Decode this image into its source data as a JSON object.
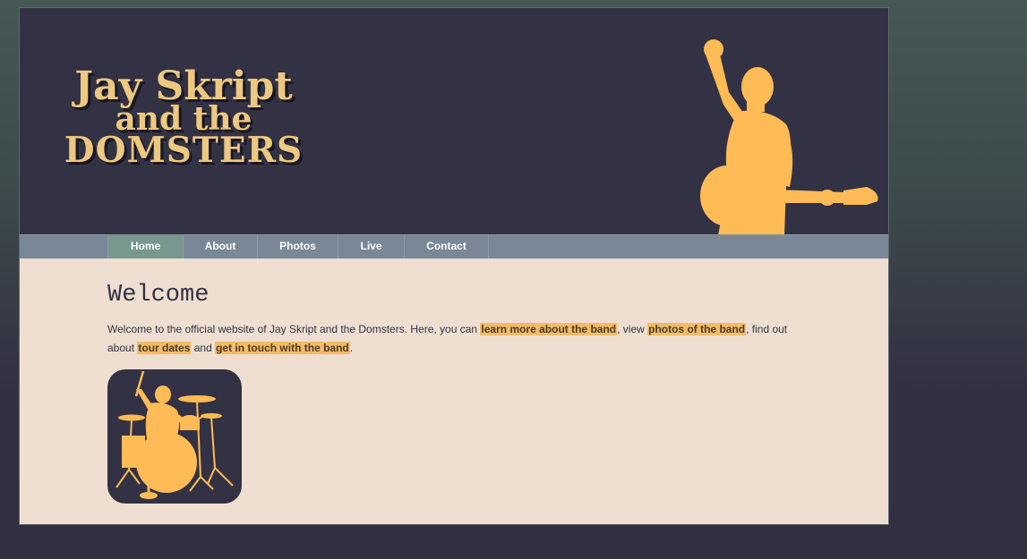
{
  "header": {
    "logo": {
      "line1": "Jay Skript",
      "line2": "and the",
      "line3": "DOMSTERS"
    }
  },
  "nav": {
    "items": [
      {
        "label": "Home",
        "active": true
      },
      {
        "label": "About",
        "active": false
      },
      {
        "label": "Photos",
        "active": false
      },
      {
        "label": "Live",
        "active": false
      },
      {
        "label": "Contact",
        "active": false
      }
    ]
  },
  "main": {
    "title": "Welcome",
    "intro": {
      "t1": "Welcome to the official website of Jay Skript and the Domsters. Here, you can ",
      "link1": "learn more about the band",
      "t2": ", view ",
      "link2": "photos of the band",
      "t3": ", find out about ",
      "link3": "tour dates",
      "t4": " and ",
      "link4": "get in touch with the band",
      "t5": "."
    }
  },
  "colors": {
    "header_bg": "#333244",
    "accent": "#ffbb55",
    "logo_text": "#ecc880",
    "nav_bg": "#798797",
    "nav_active": "#78988f",
    "content_bg": "#efdfd0"
  },
  "icons": {
    "guitarist": "guitarist-silhouette-icon",
    "drummer": "drummer-silhouette-icon"
  }
}
